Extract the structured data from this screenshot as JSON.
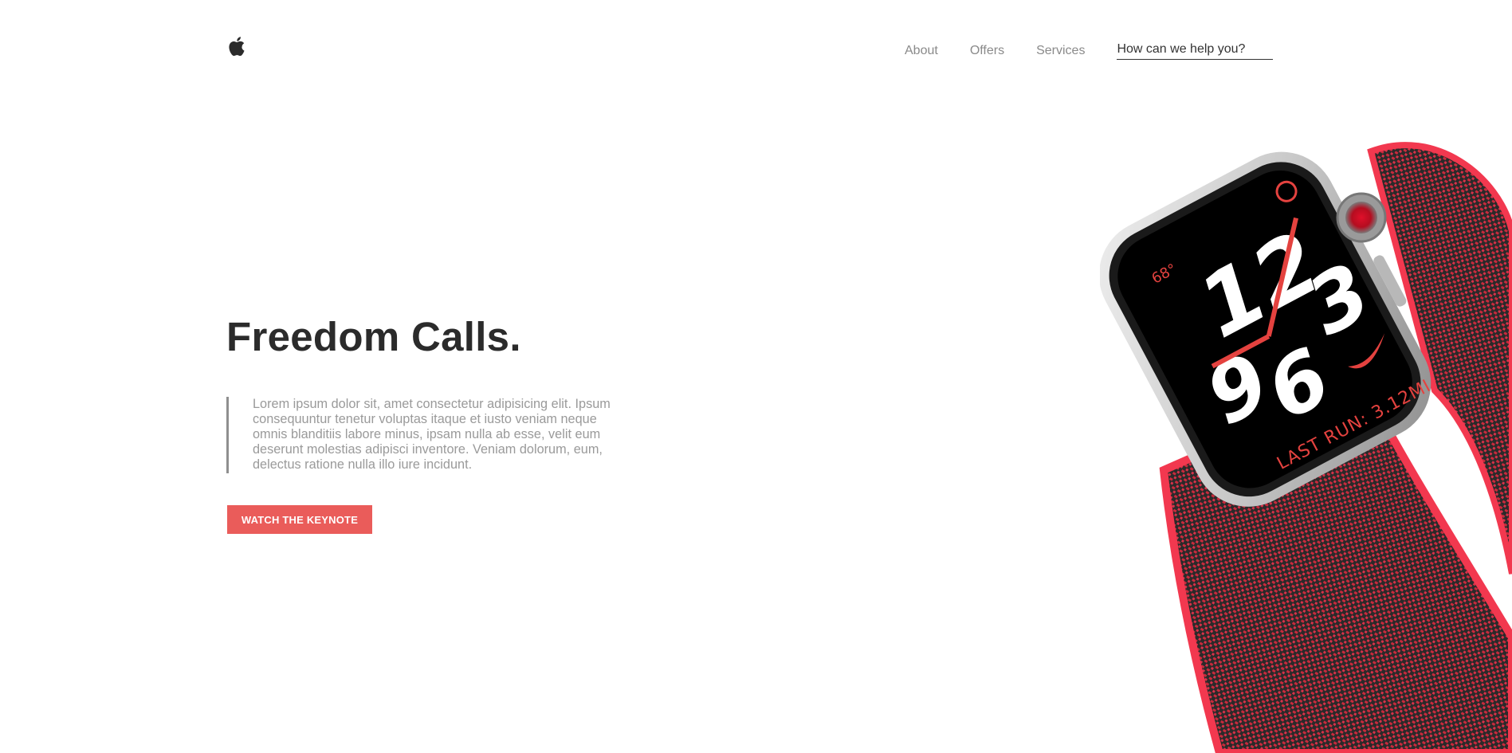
{
  "header": {
    "logo_icon": "apple-logo-icon",
    "nav": {
      "about": "About",
      "offers": "Offers",
      "services": "Services"
    },
    "search": {
      "placeholder": "How can we help you?"
    }
  },
  "hero": {
    "title": "Freedom Calls.",
    "description": "Lorem ipsum dolor sit, amet consectetur adipisicing elit. Ipsum consequuntur tenetur voluptas itaque et iusto veniam neque omnis blanditiis labore minus, ipsam nulla ab esse, velit eum deserunt molestias adipisci inventore. Veniam dolorum, eum, delectus ratione nulla illo iure incidunt.",
    "cta_label": "WATCH THE KEYNOTE"
  },
  "watch_face": {
    "temperature": "68°",
    "hour_12": "12",
    "hour_3": "3",
    "hour_9": "9",
    "hour_6": "6",
    "complication": "LAST RUN: 3.12MI"
  },
  "colors": {
    "accent": "#ea5c5a",
    "title": "#2b2b2b",
    "body": "#9a9a9a",
    "band_red": "#f2384f",
    "band_dark": "#2a2a2a"
  }
}
